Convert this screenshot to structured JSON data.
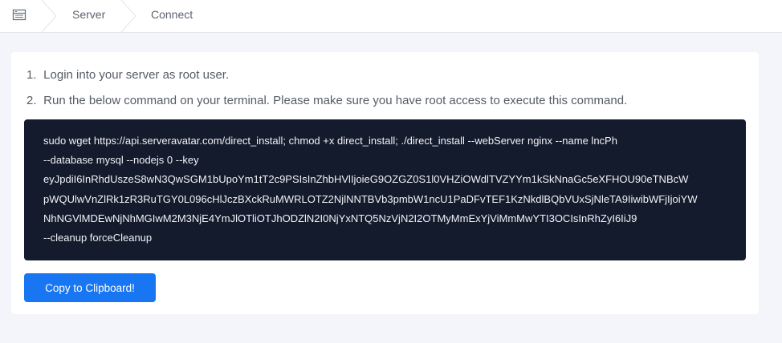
{
  "breadcrumb": {
    "home_icon": "server-list-icon",
    "items": [
      {
        "label": "Server"
      },
      {
        "label": "Connect"
      }
    ]
  },
  "instructions": {
    "steps": [
      {
        "number": "1.",
        "text": "Login into your server as root user."
      },
      {
        "number": "2.",
        "text": "Run the below command on your terminal. Please make sure you have root access to execute this command."
      }
    ]
  },
  "command": {
    "lines": [
      "sudo wget https://api.serveravatar.com/direct_install; chmod +x direct_install; ./direct_install --webServer nginx --name lncPh",
      "--database mysql --nodejs 0 --key",
      "eyJpdiI6InRhdUszeS8wN3QwSGM1bUpoYm1tT2c9PSIsInZhbHVlIjoieG9OZGZ0S1l0VHZiOWdlTVZYYm1kSkNnaGc5eXFHOU90eTNBcW",
      "pWQUlwVnZlRk1zR3RuTGY0L096cHlJczBXckRuMWRLOTZ2NjlNNTBVb3pmbW1ncU1PaDFvTEF1KzNkdlBQbVUxSjNleTA9IiwibWFjIjoiYW",
      "NhNGVlMDEwNjNhMGIwM2M3NjE4YmJlOTliOTJhODZlN2I0NjYxNTQ5NzVjN2I2OTMyMmExYjViMmMwYTI3OCIsInRhZyI6IiJ9",
      "--cleanup forceCleanup"
    ]
  },
  "copy_button": {
    "label": "Copy to Clipboard!"
  },
  "colors": {
    "accent": "#1976f2",
    "code_bg": "#141b2c",
    "page_bg": "#f4f5fa"
  }
}
